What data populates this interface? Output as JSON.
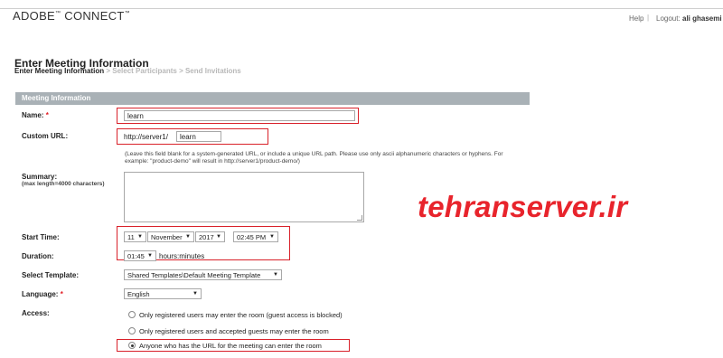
{
  "header": {
    "logo_text": "ADOBE",
    "logo_text2": "CONNECT",
    "logo_mark": "™",
    "help_label": "Help",
    "separator": "|",
    "logout_label": "Logout:",
    "user_name": "ali ghasemi"
  },
  "page": {
    "title": "Enter Meeting Information",
    "steps": [
      "Enter Meeting Information",
      "> Select Participants",
      "> Send Invitations"
    ]
  },
  "form": {
    "section_title": "Meeting Information",
    "name_label": "Name:",
    "required_mark": "*",
    "name_value": "learn",
    "custom_url_label": "Custom URL:",
    "url_prefix": "http://server1/",
    "url_value": "learn",
    "url_note": "(Leave this field blank for a system-generated URL, or include a unique URL path. Please use only ascii alphanumeric characters or hyphens. For example: \"product-demo\" will result in http://server1/product-demo/)",
    "summary_label": "Summary:",
    "summary_hint": "(max length=4000 characters)",
    "start_time_label": "Start Time:",
    "start_day": "11",
    "start_month": "November",
    "start_year": "2017",
    "start_time": "02:45 PM",
    "duration_label": "Duration:",
    "duration_value": "01:45",
    "duration_unit": "hours:minutes",
    "template_label": "Select Template:",
    "template_value": "Shared Templates\\Default Meeting Template",
    "language_label": "Language:",
    "language_value": "English",
    "access_label": "Access:",
    "access_options": [
      "Only registered users may enter the room (guest access is blocked)",
      "Only registered users and accepted guests may enter the room",
      "Anyone who has the URL for the meeting can enter the room"
    ],
    "access_selected_index": 2
  },
  "watermark": {
    "text": "tehranserver.ir"
  },
  "colors": {
    "highlight": "#d9212a",
    "section_header": "#a9b1b6",
    "watermark": "#e8242c"
  },
  "icons": {
    "dropdown": "triangle-down"
  }
}
